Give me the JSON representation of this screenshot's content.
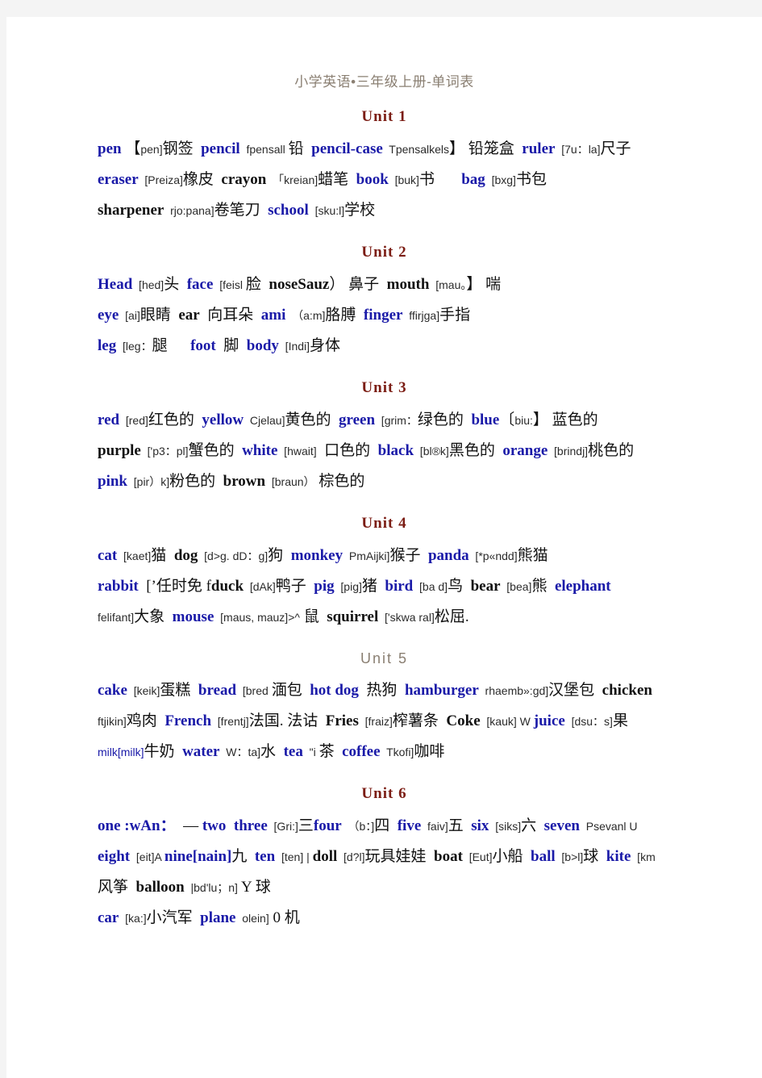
{
  "document": {
    "title": "小学英语•三年级上册-单词表",
    "page_background": "#ffffff",
    "margin_background": "#f4f4f4",
    "headword_color": "#1a1aa8",
    "unit_heading_color": "#7b1d14",
    "title_color": "#8a7f72"
  },
  "units": [
    {
      "heading": "Unit 1",
      "heading_style": "serif-bold-maroon",
      "lines": [
        [
          {
            "t": "pen",
            "k": "w"
          },
          {
            "t": " 【",
            "k": "cn"
          },
          {
            "t": "pen]",
            "k": "ph"
          },
          {
            "t": "钢签",
            "k": "cn"
          },
          {
            "t": "  ",
            "k": "cn"
          },
          {
            "t": "pencil",
            "k": "w"
          },
          {
            "t": "  fpensall ",
            "k": "ph"
          },
          {
            "t": "铅",
            "k": "cn"
          },
          {
            "t": "  ",
            "k": "cn"
          },
          {
            "t": "pencil-case",
            "k": "w"
          },
          {
            "t": "  Tpensalkels",
            "k": "ph"
          },
          {
            "t": "】",
            "k": "cn"
          },
          {
            "t": " 铅笼盒  ",
            "k": "cn"
          },
          {
            "t": "ruler",
            "k": "w"
          },
          {
            "t": "  [7u：la]",
            "k": "ph"
          },
          {
            "t": "尺子",
            "k": "cn"
          }
        ],
        [
          {
            "t": "eraser",
            "k": "w"
          },
          {
            "t": "  [Preiza]",
            "k": "ph"
          },
          {
            "t": "橡皮",
            "k": "cn"
          },
          {
            "t": "  ",
            "k": "cn"
          },
          {
            "t": "crayon",
            "k": "wk"
          },
          {
            "t": "  「kreian]",
            "k": "ph"
          },
          {
            "t": "蜡笔",
            "k": "cn"
          },
          {
            "t": "  ",
            "k": "cn"
          },
          {
            "t": "book",
            "k": "w"
          },
          {
            "t": "  [buk]",
            "k": "ph"
          },
          {
            "t": "书",
            "k": "cn"
          },
          {
            "t": "       ",
            "k": "cn"
          },
          {
            "t": "bag",
            "k": "w"
          },
          {
            "t": "  [bxg]",
            "k": "ph"
          },
          {
            "t": "书包",
            "k": "cn"
          }
        ],
        [
          {
            "t": "sharpener",
            "k": "wk"
          },
          {
            "t": "  rjo:pana]",
            "k": "ph"
          },
          {
            "t": "卷笔刀",
            "k": "cn"
          },
          {
            "t": "  ",
            "k": "cn"
          },
          {
            "t": "school",
            "k": "w"
          },
          {
            "t": "  [sku:l]",
            "k": "ph"
          },
          {
            "t": "学校",
            "k": "cn"
          }
        ]
      ]
    },
    {
      "heading": "Unit 2",
      "heading_style": "serif-bold-maroon",
      "lines": [
        [
          {
            "t": "Head",
            "k": "w"
          },
          {
            "t": "  [hed]",
            "k": "ph"
          },
          {
            "t": "头",
            "k": "cn"
          },
          {
            "t": "  ",
            "k": "cn"
          },
          {
            "t": "face",
            "k": "w"
          },
          {
            "t": "  [feisl ",
            "k": "ph"
          },
          {
            "t": "脸",
            "k": "cn"
          },
          {
            "t": "  ",
            "k": "cn"
          },
          {
            "t": "noseSauz",
            "k": "wk"
          },
          {
            "t": "）",
            "k": "cn"
          },
          {
            "t": " 鼻子  ",
            "k": "cn"
          },
          {
            "t": "mouth",
            "k": "wk"
          },
          {
            "t": "  [mau。",
            "k": "ph"
          },
          {
            "t": "】 喘",
            "k": "cn"
          }
        ],
        [
          {
            "t": "eye",
            "k": "w"
          },
          {
            "t": "  [ai]",
            "k": "ph"
          },
          {
            "t": "眼睛",
            "k": "cn"
          },
          {
            "t": "  ",
            "k": "cn"
          },
          {
            "t": "ear",
            "k": "wk"
          },
          {
            "t": "  向耳朵  ",
            "k": "cn"
          },
          {
            "t": "ami",
            "k": "w"
          },
          {
            "t": "  （a:m]",
            "k": "ph"
          },
          {
            "t": "胳膊",
            "k": "cn"
          },
          {
            "t": "  ",
            "k": "cn"
          },
          {
            "t": "finger",
            "k": "w"
          },
          {
            "t": "  ffirjga]",
            "k": "ph"
          },
          {
            "t": "手指",
            "k": "cn"
          }
        ],
        [
          {
            "t": "leg",
            "k": "w"
          },
          {
            "t": "  [leg：",
            "k": "ph"
          },
          {
            "t": "腿",
            "k": "cn"
          },
          {
            "t": "      ",
            "k": "cn"
          },
          {
            "t": "foot",
            "k": "w"
          },
          {
            "t": "  脚  ",
            "k": "cn"
          },
          {
            "t": "body",
            "k": "w"
          },
          {
            "t": "  [Indi]",
            "k": "ph"
          },
          {
            "t": "身体",
            "k": "cn"
          }
        ]
      ]
    },
    {
      "heading": "Unit 3",
      "heading_style": "serif-bold-maroon",
      "lines": [
        [
          {
            "t": "red",
            "k": "w"
          },
          {
            "t": "  [red]",
            "k": "ph"
          },
          {
            "t": "红色的",
            "k": "cn"
          },
          {
            "t": "  ",
            "k": "cn"
          },
          {
            "t": "yellow",
            "k": "w"
          },
          {
            "t": "  Cjelau]",
            "k": "ph"
          },
          {
            "t": "黄色的",
            "k": "cn"
          },
          {
            "t": "  ",
            "k": "cn"
          },
          {
            "t": "green",
            "k": "w"
          },
          {
            "t": "  [grim：",
            "k": "ph"
          },
          {
            "t": "绿色的",
            "k": "cn"
          },
          {
            "t": "  ",
            "k": "cn"
          },
          {
            "t": "blue",
            "k": "w"
          },
          {
            "t": "〔",
            "k": "cn"
          },
          {
            "t": "biu:",
            "k": "ph"
          },
          {
            "t": "】 蓝色的",
            "k": "cn"
          }
        ],
        [
          {
            "t": "purple",
            "k": "wk"
          },
          {
            "t": "  ['p3：pl]",
            "k": "ph"
          },
          {
            "t": "蟹色的",
            "k": "cn"
          },
          {
            "t": "  ",
            "k": "cn"
          },
          {
            "t": "white",
            "k": "w"
          },
          {
            "t": "  [hwait]",
            "k": "ph"
          },
          {
            "t": "  口色的  ",
            "k": "cn"
          },
          {
            "t": "black",
            "k": "w"
          },
          {
            "t": "  [bl®k]",
            "k": "ph"
          },
          {
            "t": "黑色的",
            "k": "cn"
          },
          {
            "t": "  ",
            "k": "cn"
          },
          {
            "t": "orange",
            "k": "w"
          },
          {
            "t": "  [brindj]",
            "k": "ph"
          },
          {
            "t": "桃色的",
            "k": "cn"
          }
        ],
        [
          {
            "t": "pink",
            "k": "w"
          },
          {
            "t": "  [pir）k]",
            "k": "ph"
          },
          {
            "t": "粉色的",
            "k": "cn"
          },
          {
            "t": "  ",
            "k": "cn"
          },
          {
            "t": "brown",
            "k": "wk"
          },
          {
            "t": "  [braun）",
            "k": "ph"
          },
          {
            "t": " 棕色的",
            "k": "cn"
          }
        ]
      ]
    },
    {
      "heading": "Unit 4",
      "heading_style": "serif-bold-maroon",
      "lines": [
        [
          {
            "t": "cat",
            "k": "w"
          },
          {
            "t": "  [kaet]",
            "k": "ph"
          },
          {
            "t": "猫",
            "k": "cn"
          },
          {
            "t": "  ",
            "k": "cn"
          },
          {
            "t": "dog",
            "k": "wk"
          },
          {
            "t": "  [d>g. dD：g]",
            "k": "ph"
          },
          {
            "t": "狗",
            "k": "cn"
          },
          {
            "t": "  ",
            "k": "cn"
          },
          {
            "t": "monkey",
            "k": "w"
          },
          {
            "t": "  PmAijki]",
            "k": "ph"
          },
          {
            "t": "猴子",
            "k": "cn"
          },
          {
            "t": "  ",
            "k": "cn"
          },
          {
            "t": "panda",
            "k": "w"
          },
          {
            "t": "  [*p«ndd]",
            "k": "ph"
          },
          {
            "t": "熊猫",
            "k": "cn"
          }
        ],
        [
          {
            "t": "rabbit",
            "k": "w"
          },
          {
            "t": "  [’任时免 f",
            "k": "cn"
          },
          {
            "t": "duck",
            "k": "wk"
          },
          {
            "t": "  [dAk]",
            "k": "ph"
          },
          {
            "t": "鸭子",
            "k": "cn"
          },
          {
            "t": "  ",
            "k": "cn"
          },
          {
            "t": "pig",
            "k": "w"
          },
          {
            "t": "  [pig]",
            "k": "ph"
          },
          {
            "t": "猪",
            "k": "cn"
          },
          {
            "t": "  ",
            "k": "cn"
          },
          {
            "t": "bird",
            "k": "w"
          },
          {
            "t": "  [ba d]",
            "k": "ph"
          },
          {
            "t": "鸟",
            "k": "cn"
          },
          {
            "t": "  ",
            "k": "cn"
          },
          {
            "t": "bear",
            "k": "wk"
          },
          {
            "t": "  [bea]",
            "k": "ph"
          },
          {
            "t": "熊",
            "k": "cn"
          },
          {
            "t": "  ",
            "k": "cn"
          },
          {
            "t": "elephant",
            "k": "w"
          }
        ],
        [
          {
            "t": "felifant]",
            "k": "ph"
          },
          {
            "t": "大象",
            "k": "cn"
          },
          {
            "t": "  ",
            "k": "cn"
          },
          {
            "t": "mouse",
            "k": "w"
          },
          {
            "t": "  [maus, mauz]>^",
            "k": "ph"
          },
          {
            "t": " 鼠  ",
            "k": "cn"
          },
          {
            "t": "squirrel",
            "k": "wk"
          },
          {
            "t": "  ['skwa ral]",
            "k": "ph"
          },
          {
            "t": "松屈.",
            "k": "cn"
          }
        ]
      ]
    },
    {
      "heading": "Unit 5",
      "heading_style": "sans-gray",
      "lines": [
        [
          {
            "t": "cake",
            "k": "w"
          },
          {
            "t": "  [keik]",
            "k": "ph"
          },
          {
            "t": "蛋糕",
            "k": "cn"
          },
          {
            "t": "  ",
            "k": "cn"
          },
          {
            "t": "bread",
            "k": "w"
          },
          {
            "t": "  [bred ",
            "k": "ph"
          },
          {
            "t": "湎包",
            "k": "cn"
          },
          {
            "t": "  ",
            "k": "cn"
          },
          {
            "t": "hot dog",
            "k": "w"
          },
          {
            "t": "  热狗  ",
            "k": "cn"
          },
          {
            "t": "hamburger",
            "k": "w"
          },
          {
            "t": "  rhaemb»:gd]",
            "k": "ph"
          },
          {
            "t": "汉堡包",
            "k": "cn"
          },
          {
            "t": "  ",
            "k": "cn"
          },
          {
            "t": "chicken",
            "k": "wk"
          }
        ],
        [
          {
            "t": "ftjikin]",
            "k": "ph"
          },
          {
            "t": "鸡肉",
            "k": "cn"
          },
          {
            "t": "  ",
            "k": "cn"
          },
          {
            "t": "French",
            "k": "w"
          },
          {
            "t": "  [frentj]",
            "k": "ph"
          },
          {
            "t": "法国. 法诂  ",
            "k": "cn"
          },
          {
            "t": "Fries",
            "k": "wk"
          },
          {
            "t": "  [fraiz]",
            "k": "ph"
          },
          {
            "t": "榨薯条",
            "k": "cn"
          },
          {
            "t": "  ",
            "k": "cn"
          },
          {
            "t": "Coke",
            "k": "wk"
          },
          {
            "t": "  [kauk] W ",
            "k": "ph"
          },
          {
            "t": "juice",
            "k": "w"
          },
          {
            "t": "  [dsu：s]",
            "k": "ph"
          },
          {
            "t": "果",
            "k": "cn"
          }
        ],
        [
          {
            "t": "milk[milk]",
            "k": "ph blue"
          },
          {
            "t": "牛奶",
            "k": "cn"
          },
          {
            "t": "  ",
            "k": "cn"
          },
          {
            "t": "water",
            "k": "w"
          },
          {
            "t": "  W：ta]",
            "k": "ph"
          },
          {
            "t": "水",
            "k": "cn"
          },
          {
            "t": "  ",
            "k": "cn"
          },
          {
            "t": "tea",
            "k": "w"
          },
          {
            "t": "  \"i ",
            "k": "ph"
          },
          {
            "t": "茶",
            "k": "cn"
          },
          {
            "t": "  ",
            "k": "cn"
          },
          {
            "t": "coffee",
            "k": "w"
          },
          {
            "t": "  Tkofi]",
            "k": "ph"
          },
          {
            "t": "咖啡",
            "k": "cn"
          }
        ]
      ]
    },
    {
      "heading": "Unit 6",
      "heading_style": "serif-bold-maroon",
      "lines": [
        [
          {
            "t": "one :wAn：",
            "k": "w"
          },
          {
            "t": "  — ",
            "k": "cn"
          },
          {
            "t": "two",
            "k": "w"
          },
          {
            "t": "  ",
            "k": "cn"
          },
          {
            "t": "three",
            "k": "w"
          },
          {
            "t": "  [Gri:]",
            "k": "ph"
          },
          {
            "t": "三",
            "k": "cn"
          },
          {
            "t": "",
            "k": "cn"
          },
          {
            "t": "four",
            "k": "w"
          },
          {
            "t": "  （b：]",
            "k": "ph"
          },
          {
            "t": "四",
            "k": "cn"
          },
          {
            "t": "  ",
            "k": "cn"
          },
          {
            "t": "five",
            "k": "w"
          },
          {
            "t": "  faiv]",
            "k": "ph"
          },
          {
            "t": "五",
            "k": "cn"
          },
          {
            "t": "  ",
            "k": "cn"
          },
          {
            "t": "six",
            "k": "w"
          },
          {
            "t": "  [siks]",
            "k": "ph"
          },
          {
            "t": "六",
            "k": "cn"
          },
          {
            "t": "  ",
            "k": "cn"
          },
          {
            "t": "seven",
            "k": "w"
          },
          {
            "t": "  Psevanl U",
            "k": "ph"
          }
        ],
        [
          {
            "t": "eight",
            "k": "w"
          },
          {
            "t": "  [eit]A ",
            "k": "ph"
          },
          {
            "t": "nine[nain]",
            "k": "w"
          },
          {
            "t": "九",
            "k": "cn"
          },
          {
            "t": "  ",
            "k": "cn"
          },
          {
            "t": "ten",
            "k": "w"
          },
          {
            "t": "  [ten] | ",
            "k": "ph"
          },
          {
            "t": "doll",
            "k": "wk"
          },
          {
            "t": "  [d?l]",
            "k": "ph"
          },
          {
            "t": "玩具娃娃",
            "k": "cn"
          },
          {
            "t": "  ",
            "k": "cn"
          },
          {
            "t": "boat",
            "k": "wk"
          },
          {
            "t": "  [Eut]",
            "k": "ph"
          },
          {
            "t": "小船",
            "k": "cn"
          },
          {
            "t": "  ",
            "k": "cn"
          },
          {
            "t": "ball",
            "k": "w"
          },
          {
            "t": "  [b>l]",
            "k": "ph"
          },
          {
            "t": "球",
            "k": "cn"
          },
          {
            "t": "  ",
            "k": "cn"
          },
          {
            "t": "kite",
            "k": "w"
          },
          {
            "t": "  [km",
            "k": "ph"
          }
        ],
        [
          {
            "t": "风筝  ",
            "k": "cn"
          },
          {
            "t": "balloon",
            "k": "wk"
          },
          {
            "t": "  |bd'lu；n]",
            "k": "ph"
          },
          {
            "t": " Y 球",
            "k": "cn"
          }
        ],
        [
          {
            "t": "car",
            "k": "w"
          },
          {
            "t": "  [ka:]",
            "k": "ph"
          },
          {
            "t": "小汽军",
            "k": "cn"
          },
          {
            "t": "  ",
            "k": "cn"
          },
          {
            "t": "plane",
            "k": "w"
          },
          {
            "t": "  olein]",
            "k": "ph"
          },
          {
            "t": " 0 机",
            "k": "cn"
          }
        ]
      ]
    }
  ]
}
